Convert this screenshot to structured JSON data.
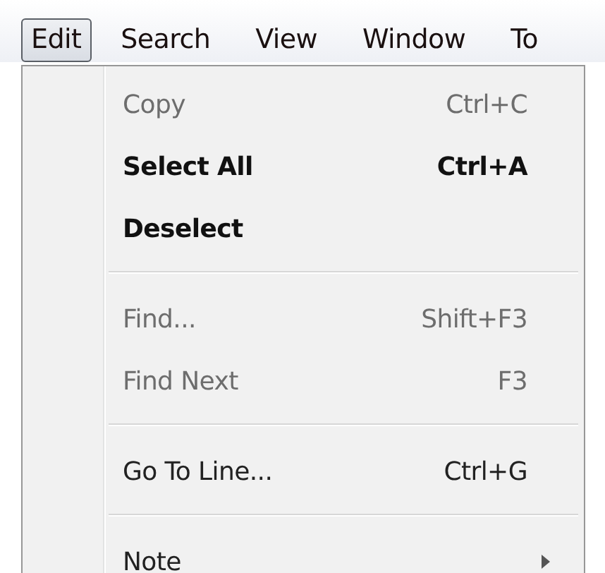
{
  "menu_bar": [
    {
      "label": "Edit",
      "selected": true
    },
    {
      "label": "Search",
      "selected": false
    },
    {
      "label": "View",
      "selected": false
    },
    {
      "label": "Window",
      "selected": false
    },
    {
      "label": "To",
      "selected": false
    }
  ],
  "menu": [
    {
      "kind": "item",
      "label": "Copy",
      "shortcut": "Ctrl+C",
      "disabled": true,
      "bold": false
    },
    {
      "kind": "item",
      "label": "Select All",
      "shortcut": "Ctrl+A",
      "disabled": false,
      "bold": true
    },
    {
      "kind": "item",
      "label": "Deselect",
      "disabled": false,
      "bold": true
    },
    {
      "kind": "separator"
    },
    {
      "kind": "item",
      "label": "Find...",
      "shortcut": "Shift+F3",
      "disabled": true,
      "bold": false
    },
    {
      "kind": "item",
      "label": "Find Next",
      "shortcut": "F3",
      "disabled": true,
      "bold": false
    },
    {
      "kind": "separator"
    },
    {
      "kind": "item",
      "label": "Go To Line...",
      "shortcut": "Ctrl+G",
      "disabled": false,
      "bold": false
    },
    {
      "kind": "separator"
    },
    {
      "kind": "submenu",
      "label": "Note",
      "disabled": false,
      "bold": false
    }
  ]
}
